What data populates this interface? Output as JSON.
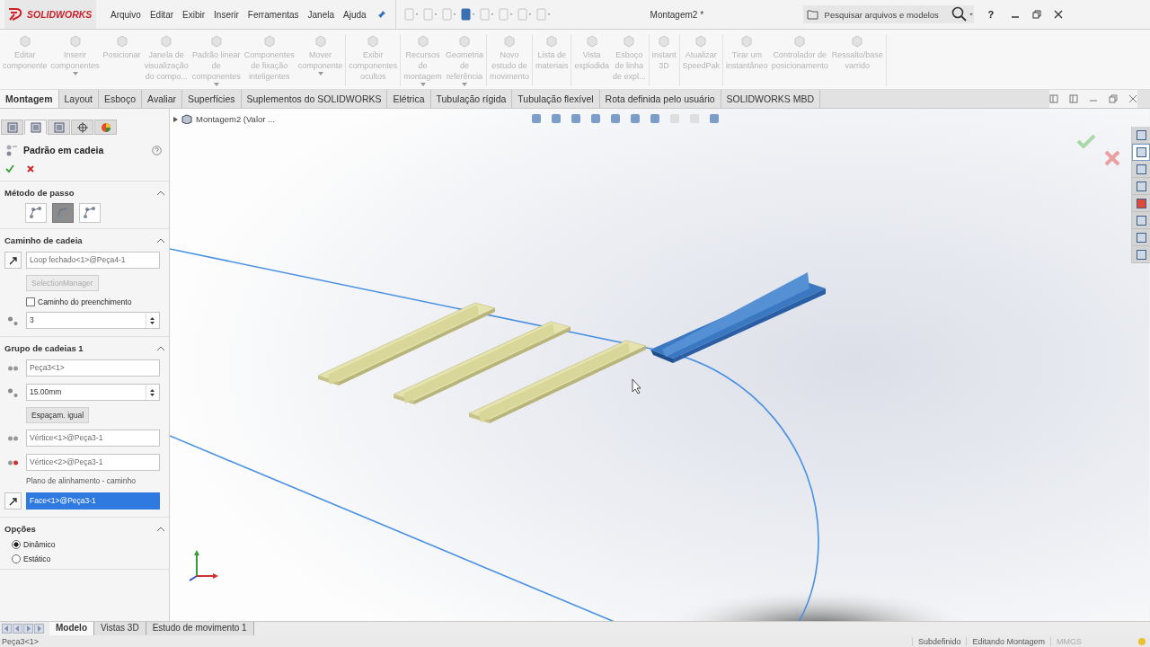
{
  "titlebar": {
    "logo": "SOLIDWORKS",
    "menus": [
      "Arquivo",
      "Editar",
      "Exibir",
      "Inserir",
      "Ferramentas",
      "Janela",
      "Ajuda"
    ],
    "title": "Montagem2 *",
    "search": {
      "placeholder": "Pesquisar arquivos e modelos"
    },
    "help": "?"
  },
  "ribbon": {
    "groups": [
      [
        {
          "label": "Editar\ncomponente",
          "dropdown": false,
          "disabled": true
        },
        {
          "label": "Inserir\ncomponentes",
          "dropdown": true,
          "disabled": true
        },
        {
          "label": "Posicionar",
          "dropdown": false,
          "disabled": true
        },
        {
          "label": "Janela de\nvisualização\ndo compo...",
          "dropdown": false,
          "disabled": true
        },
        {
          "label": "Padrão linear\nde\ncomponentes",
          "dropdown": true,
          "disabled": true
        },
        {
          "label": "Componentes\nde fixação\ninteligentes",
          "dropdown": false,
          "disabled": true
        },
        {
          "label": "Mover\ncomponente",
          "dropdown": true,
          "disabled": true
        }
      ],
      [
        {
          "label": "Exibir\ncomponentes\nocultos",
          "dropdown": false,
          "disabled": true
        }
      ],
      [
        {
          "label": "Recursos\nde\nmontagem",
          "dropdown": true,
          "disabled": true
        },
        {
          "label": "Geometria\nde\nreferência",
          "dropdown": true,
          "disabled": true
        }
      ],
      [
        {
          "label": "Novo\nestudo de\nmovimento",
          "dropdown": false,
          "disabled": true
        }
      ],
      [
        {
          "label": "Lista de\nmateriais",
          "dropdown": false,
          "disabled": true
        }
      ],
      [
        {
          "label": "Vista\nexplodida",
          "dropdown": false,
          "disabled": true
        },
        {
          "label": "Esboço\nde linha\nde expl...",
          "dropdown": false,
          "disabled": true
        }
      ],
      [
        {
          "label": "Instant\n3D",
          "dropdown": false,
          "disabled": true
        }
      ],
      [
        {
          "label": "Atualizar\nSpeedPak",
          "dropdown": false,
          "disabled": true
        }
      ],
      [
        {
          "label": "Tirar um\ninstantâneo",
          "dropdown": false,
          "disabled": true
        },
        {
          "label": "Controlador de\nposicionamento",
          "dropdown": false,
          "disabled": true
        },
        {
          "label": "Ressalto/base\nvarrido",
          "dropdown": false,
          "disabled": true
        }
      ]
    ]
  },
  "tabs": [
    {
      "label": "Montagem",
      "selected": true
    },
    {
      "label": "Layout",
      "selected": false
    },
    {
      "label": "Esboço",
      "selected": false
    },
    {
      "label": "Avaliar",
      "selected": false
    },
    {
      "label": "Superfícies",
      "selected": false
    },
    {
      "label": "Suplementos do SOLIDWORKS",
      "selected": false
    },
    {
      "label": "Elétrica",
      "selected": false
    },
    {
      "label": "Tubulação rígida",
      "selected": false
    },
    {
      "label": "Tubulação flexível",
      "selected": false
    },
    {
      "label": "Rota definida pelo usuário",
      "selected": false
    },
    {
      "label": "SOLIDWORKS MBD",
      "selected": false
    }
  ],
  "property_manager": {
    "panel_tabs": [
      {
        "selected": false
      },
      {
        "selected": true
      },
      {
        "selected": false
      },
      {
        "selected": false
      },
      {
        "selected": false
      }
    ],
    "title": "Padrão em cadeia",
    "sections": [
      {
        "title": "Método de passo",
        "items": [
          {
            "kind": "icons",
            "options": [
              {
                "selected": false
              },
              {
                "selected": true
              },
              {
                "selected": false
              }
            ]
          }
        ]
      },
      {
        "title": "Caminho de cadeia",
        "items": [
          {
            "kind": "selection",
            "value": "Loop fechado<1>@Peça4-1",
            "selected": false
          },
          {
            "kind": "button",
            "label": "SelectionManager",
            "disabled": true
          },
          {
            "kind": "checkbox",
            "label": "Caminho do preenchimento",
            "checked": false
          },
          {
            "kind": "spin",
            "value": "3"
          }
        ]
      },
      {
        "title": "Grupo de cadeias 1",
        "items": [
          {
            "kind": "field",
            "value": "Peça3<1>"
          },
          {
            "kind": "spin",
            "value": "15.00mm"
          },
          {
            "kind": "button",
            "label": "Espaçam. igual",
            "disabled": false
          },
          {
            "kind": "field",
            "value": "Vértice<1>@Peça3-1"
          },
          {
            "kind": "field",
            "value": "Vértice<2>@Peça3-1"
          },
          {
            "kind": "note",
            "label": "Plano de alinhamento - caminho"
          },
          {
            "kind": "selection",
            "value": "Face<1>@Peça3-1",
            "selected": true
          }
        ]
      },
      {
        "title": "Opções",
        "items": [
          {
            "kind": "radio",
            "label": "Dinâmico",
            "selected": true
          },
          {
            "kind": "radio",
            "label": "Estático",
            "selected": false
          }
        ]
      }
    ]
  },
  "viewport": {
    "tree_flyout": "Montagem2  (Valor ...",
    "task_pane": [
      {
        "selected": false
      },
      {
        "selected": true
      },
      {
        "selected": false
      },
      {
        "selected": false
      },
      {
        "selected": false
      },
      {
        "selected": false
      },
      {
        "selected": false
      },
      {
        "selected": false
      }
    ]
  },
  "bottom_tabs": [
    {
      "label": "Modelo",
      "selected": true
    },
    {
      "label": "Vistas 3D",
      "selected": false
    },
    {
      "label": "Estudo de movimento 1",
      "selected": false
    }
  ],
  "status_bar": {
    "selection": "Peça3<1>",
    "items": [
      "Subdefinido",
      "Editando Montagem",
      "MMGS"
    ]
  }
}
